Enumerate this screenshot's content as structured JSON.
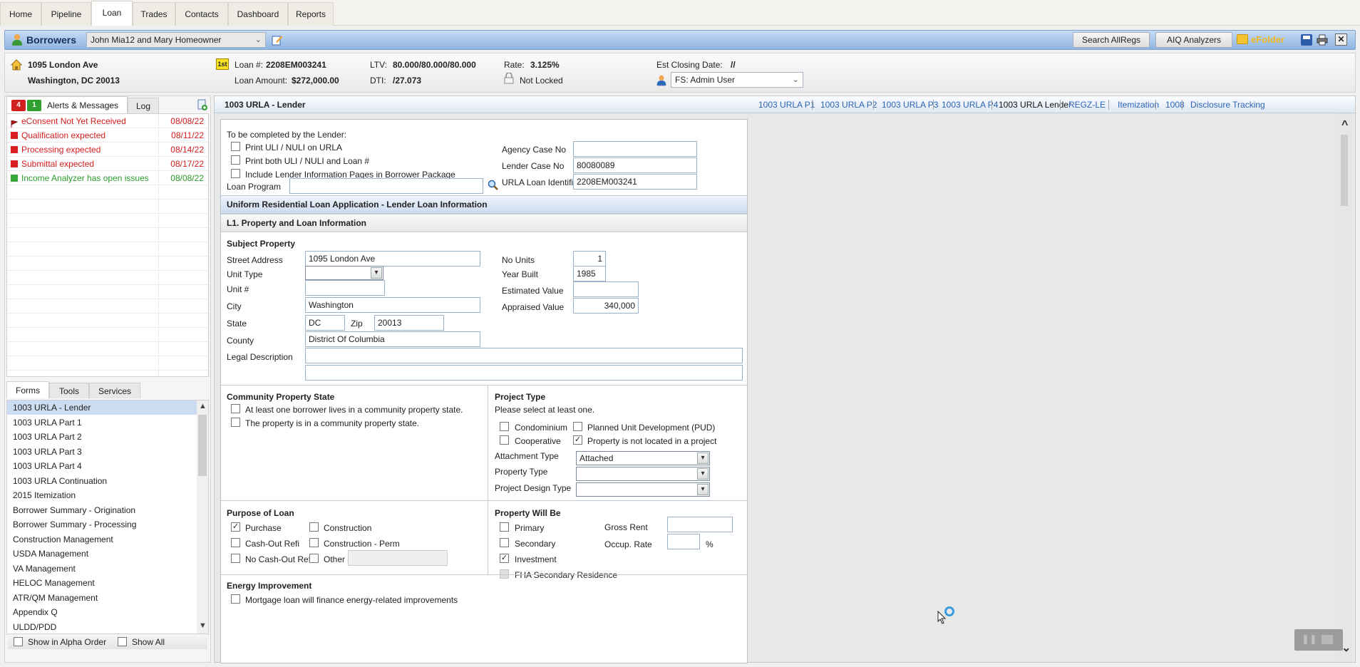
{
  "topnav": {
    "tabs": [
      {
        "label": "Home"
      },
      {
        "label": "Pipeline"
      },
      {
        "label": "Loan",
        "active": true
      },
      {
        "label": "Trades"
      },
      {
        "label": "Contacts"
      },
      {
        "label": "Dashboard"
      },
      {
        "label": "Reports"
      }
    ]
  },
  "borrowers_bar": {
    "label": "Borrowers",
    "selected_borrower": "John Mia12 and Mary Homeowner",
    "search_allregs": "Search AllRegs",
    "aiq_analyzers": "AIQ Analyzers",
    "efolder": "eFolder"
  },
  "loan_header": {
    "address_line1": "1095 London Ave",
    "address_line2": "Washington, DC 20013",
    "lien_badge": "1st",
    "loan_number_label": "Loan #:",
    "loan_number": "2208EM003241",
    "loan_amount_label": "Loan Amount:",
    "loan_amount": "$272,000.00",
    "ltv_label": "LTV:",
    "ltv": "80.000/80.000/80.000",
    "dti_label": "DTI:",
    "dti": "/27.073",
    "rate_label": "Rate:",
    "rate": "3.125%",
    "lock_status": "Not Locked",
    "est_closing_label": "Est Closing Date:",
    "est_closing": "//",
    "assigned_user": "FS: Admin User"
  },
  "alerts_panel": {
    "red_count": "4",
    "green_count": "1",
    "tab_alerts": "Alerts & Messages",
    "tab_log": "Log",
    "items": [
      {
        "text": "eConsent Not Yet Received",
        "date": "08/08/22",
        "status": "red",
        "icon": "flag"
      },
      {
        "text": "Qualification expected",
        "date": "08/11/22",
        "status": "red",
        "icon": "square"
      },
      {
        "text": "Processing expected",
        "date": "08/14/22",
        "status": "red",
        "icon": "square"
      },
      {
        "text": "Submittal expected",
        "date": "08/17/22",
        "status": "red",
        "icon": "square"
      },
      {
        "text": "Income Analyzer has open issues",
        "date": "08/08/22",
        "status": "green",
        "icon": "square"
      }
    ]
  },
  "forms_panel": {
    "tabs": [
      "Forms",
      "Tools",
      "Services"
    ],
    "items": [
      "1003 URLA - Lender",
      "1003 URLA Part 1",
      "1003 URLA Part 2",
      "1003 URLA Part 3",
      "1003 URLA Part 4",
      "1003 URLA Continuation",
      "2015 Itemization",
      "Borrower Summary - Origination",
      "Borrower Summary - Processing",
      "Construction Management",
      "USDA Management",
      "VA Management",
      "HELOC Management",
      "ATR/QM Management",
      "Appendix Q",
      "ULDD/PDD"
    ],
    "selected_index": 0,
    "show_alpha": "Show in Alpha Order",
    "show_all": "Show All"
  },
  "main": {
    "title": "1003 URLA - Lender",
    "form_links": [
      "1003 URLA P1",
      "1003 URLA P2",
      "1003 URLA P3",
      "1003 URLA P4",
      "1003 URLA Lender",
      "REGZ-LE",
      "Itemization",
      "1008",
      "Disclosure Tracking"
    ],
    "current_link": "1003 URLA Lender"
  },
  "form": {
    "lender_heading": "To be completed by the Lender:",
    "print_uli": "Print ULI / NULI on URLA",
    "print_both": "Print both ULI / NULI and Loan #",
    "include_pages": "Include Lender Information Pages in Borrower Package",
    "loan_program_label": "Loan Program",
    "loan_program": "",
    "agency_case_label": "Agency Case No",
    "agency_case": "",
    "lender_case_label": "Lender Case No",
    "lender_case": "80080089",
    "urla_id_label": "URLA Loan Identifier",
    "urla_id": "2208EM003241",
    "section_title": "Uniform Residential Loan Application - Lender Loan Information",
    "l1_title": "L1. Property and Loan Information",
    "subject_property": "Subject Property",
    "street_label": "Street Address",
    "street": "1095 London Ave",
    "unit_type_label": "Unit Type",
    "unit_type": "",
    "unit_no_label": "Unit #",
    "unit_no": "",
    "city_label": "City",
    "city": "Washington",
    "state_label": "State",
    "state": "DC",
    "zip_label": "Zip",
    "zip": "20013",
    "county_label": "County",
    "county": "District Of Columbia",
    "legal_label": "Legal Description",
    "legal1": "",
    "legal2": "",
    "no_units_label": "No Units",
    "no_units": "1",
    "year_built_label": "Year Built",
    "year_built": "1985",
    "est_value_label": "Estimated Value",
    "est_value": "",
    "appraised_label": "Appraised Value",
    "appraised": "340,000",
    "community_title": "Community Property State",
    "community1": "At least one borrower lives in a community property state.",
    "community2": "The property is in a community property state.",
    "project_title": "Project Type",
    "project_hint": "Please select at least one.",
    "condo": "Condominium",
    "pud": "Planned Unit Development (PUD)",
    "coop": "Cooperative",
    "not_in_project": "Property is not located in a project",
    "attachment_label": "Attachment Type",
    "attachment": "Attached",
    "property_type_label": "Property Type",
    "property_type": "",
    "project_design_label": "Project Design Type",
    "project_design": "",
    "purpose_title": "Purpose of Loan",
    "purchase": "Purchase",
    "cashout": "Cash-Out Refi",
    "nocashout": "No Cash-Out Refi",
    "construction": "Construction",
    "construction_perm": "Construction - Perm",
    "other": "Other -",
    "other_value": "",
    "will_be_title": "Property Will Be",
    "primary": "Primary",
    "secondary": "Secondary",
    "investment": "Investment",
    "fha_secondary": "FHA Secondary Residence",
    "gross_rent_label": "Gross Rent",
    "gross_rent": "",
    "occup_label": "Occup. Rate",
    "occup": "",
    "pct": "%",
    "energy_title": "Energy Improvement",
    "energy1": "Mortgage loan will finance energy-related improvements",
    "check": "✓"
  },
  "icons": {
    "chevron_down": "⌄",
    "dd_arrow": "▾",
    "scroll_up": "^",
    "scroll_down": "⌄",
    "pause": "❚❚"
  }
}
